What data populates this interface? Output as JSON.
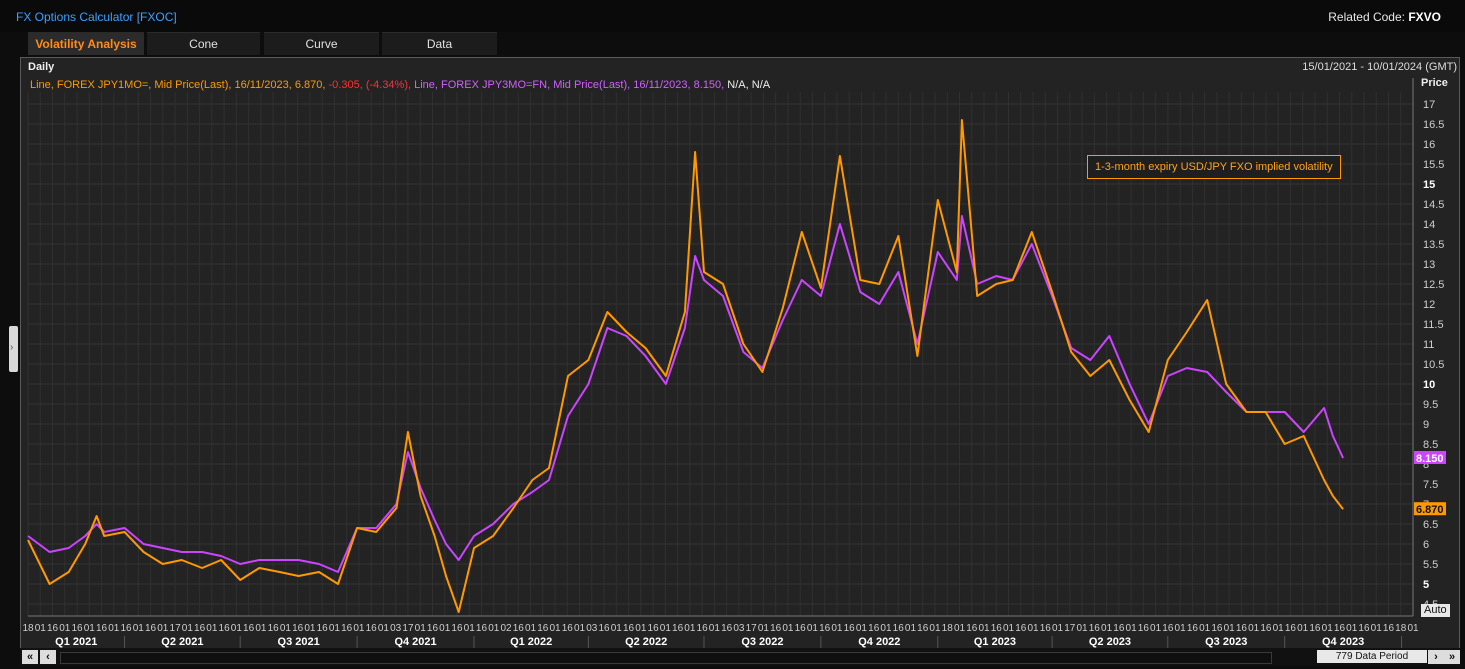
{
  "header": {
    "app_title": "FX Options Calculator [FXOC]",
    "related_label": "Related Code:",
    "related_code": "FXVO"
  },
  "tabs": [
    {
      "label": "Volatility Analysis",
      "active": true
    },
    {
      "label": "Cone",
      "active": false
    },
    {
      "label": "Curve",
      "active": false
    },
    {
      "label": "Data",
      "active": false
    }
  ],
  "chart_header": {
    "interval": "Daily",
    "date_range": "15/01/2021 - 10/01/2024 (GMT)"
  },
  "legend": {
    "s1_desc": "Line, FOREX JPY1MO=, Mid Price(Last),",
    "s1_date": "16/11/2023,",
    "s1_val": "6.870,",
    "s1_chg": "-0.305,",
    "s1_pct": "(-4.34%),",
    "s2_desc": "Line, FOREX JPY3MO=FN, Mid Price(Last),",
    "s2_date": "16/11/2023,",
    "s2_val": "8.150,",
    "s2_na": "N/A, N/A"
  },
  "annotation": "1-3-month expiry USD/JPY FXO implied volatility",
  "price_axis_label": "Price",
  "auto_label": "Auto",
  "period_label": "779 Data Period",
  "nav": {
    "first": "«",
    "prev": "‹",
    "next": "›",
    "last": "»"
  },
  "colors": {
    "series1": "#ff9900",
    "series2": "#cc44ff",
    "background": "#232323",
    "grid": "#333333"
  },
  "chart_data": {
    "type": "line",
    "ylim": [
      4.2,
      17.3
    ],
    "y_ticks": [
      4.5,
      5,
      5.5,
      6,
      6.5,
      7,
      7.5,
      8,
      8.5,
      9,
      9.5,
      10,
      10.5,
      11,
      11.5,
      12,
      12.5,
      13,
      13.5,
      14,
      14.5,
      15,
      15.5,
      16,
      16.5,
      17
    ],
    "y_bold_ticks": [
      5,
      10,
      15
    ],
    "x_day_ticks": [
      "18",
      "01",
      "16",
      "01",
      "16",
      "01",
      "16",
      "01",
      "16",
      "01",
      "16",
      "01",
      "17",
      "01",
      "16",
      "01",
      "16",
      "01",
      "16",
      "01",
      "16",
      "01",
      "16",
      "01",
      "16",
      "01",
      "16",
      "01",
      "16",
      "01",
      "03",
      "17",
      "01",
      "16",
      "01",
      "16",
      "01",
      "16",
      "01",
      "02",
      "16",
      "01",
      "16",
      "01",
      "16",
      "01",
      "03",
      "16",
      "01",
      "16",
      "01",
      "16",
      "01",
      "16",
      "01",
      "16",
      "01",
      "16",
      "03",
      "17",
      "01",
      "16",
      "01",
      "16",
      "01",
      "16",
      "01",
      "16",
      "01",
      "16",
      "01",
      "16",
      "01",
      "16",
      "01",
      "18",
      "01",
      "16",
      "01",
      "16",
      "01",
      "16",
      "01",
      "16",
      "01",
      "17",
      "01",
      "16",
      "01",
      "16",
      "01",
      "16",
      "01",
      "16",
      "01",
      "16",
      "01",
      "16",
      "01",
      "16",
      "01",
      "16",
      "01",
      "16",
      "01",
      "16",
      "01",
      "16",
      "01",
      "16",
      "01",
      "16",
      "18",
      "01"
    ],
    "quarters": [
      "Q1 2021",
      "Q2 2021",
      "Q3 2021",
      "Q4 2021",
      "Q1 2022",
      "Q2 2022",
      "Q3 2022",
      "Q4 2022",
      "Q1 2023",
      "Q2 2023",
      "Q3 2023",
      "Q4 2023"
    ],
    "last_values": {
      "JPY3MO=FN": "8.150",
      "JPY1MO=": "6.870"
    },
    "series": [
      {
        "name": "FOREX JPY1MO=",
        "points": [
          [
            "2021-01-15",
            6.1
          ],
          [
            "2021-02-01",
            5.0
          ],
          [
            "2021-02-16",
            5.3
          ],
          [
            "2021-03-01",
            6.0
          ],
          [
            "2021-03-10",
            6.7
          ],
          [
            "2021-03-16",
            6.2
          ],
          [
            "2021-04-01",
            6.3
          ],
          [
            "2021-04-16",
            5.8
          ],
          [
            "2021-05-01",
            5.5
          ],
          [
            "2021-05-16",
            5.6
          ],
          [
            "2021-06-01",
            5.4
          ],
          [
            "2021-06-16",
            5.6
          ],
          [
            "2021-07-01",
            5.1
          ],
          [
            "2021-07-16",
            5.4
          ],
          [
            "2021-08-01",
            5.3
          ],
          [
            "2021-08-16",
            5.2
          ],
          [
            "2021-09-01",
            5.3
          ],
          [
            "2021-09-16",
            5.0
          ],
          [
            "2021-10-01",
            6.4
          ],
          [
            "2021-10-16",
            6.3
          ],
          [
            "2021-11-01",
            6.9
          ],
          [
            "2021-11-10",
            8.8
          ],
          [
            "2021-11-20",
            7.2
          ],
          [
            "2021-12-01",
            6.2
          ],
          [
            "2021-12-10",
            5.2
          ],
          [
            "2021-12-20",
            4.3
          ],
          [
            "2022-01-01",
            5.9
          ],
          [
            "2022-01-16",
            6.2
          ],
          [
            "2022-02-01",
            6.9
          ],
          [
            "2022-02-16",
            7.6
          ],
          [
            "2022-03-01",
            7.9
          ],
          [
            "2022-03-16",
            10.2
          ],
          [
            "2022-04-01",
            10.6
          ],
          [
            "2022-04-16",
            11.8
          ],
          [
            "2022-05-01",
            11.3
          ],
          [
            "2022-05-16",
            10.9
          ],
          [
            "2022-06-01",
            10.2
          ],
          [
            "2022-06-16",
            11.8
          ],
          [
            "2022-06-24",
            15.8
          ],
          [
            "2022-07-01",
            12.8
          ],
          [
            "2022-07-16",
            12.5
          ],
          [
            "2022-08-01",
            11.0
          ],
          [
            "2022-08-16",
            10.3
          ],
          [
            "2022-09-01",
            11.9
          ],
          [
            "2022-09-16",
            13.8
          ],
          [
            "2022-10-01",
            12.4
          ],
          [
            "2022-10-16",
            15.7
          ],
          [
            "2022-11-01",
            12.6
          ],
          [
            "2022-11-16",
            12.5
          ],
          [
            "2022-12-01",
            13.7
          ],
          [
            "2022-12-16",
            10.7
          ],
          [
            "2023-01-01",
            14.6
          ],
          [
            "2023-01-16",
            12.8
          ],
          [
            "2023-01-20",
            16.6
          ],
          [
            "2023-02-01",
            12.2
          ],
          [
            "2023-02-16",
            12.5
          ],
          [
            "2023-03-01",
            12.6
          ],
          [
            "2023-03-16",
            13.8
          ],
          [
            "2023-04-01",
            12.3
          ],
          [
            "2023-04-16",
            10.8
          ],
          [
            "2023-05-01",
            10.2
          ],
          [
            "2023-05-16",
            10.6
          ],
          [
            "2023-06-01",
            9.6
          ],
          [
            "2023-06-16",
            8.8
          ],
          [
            "2023-07-01",
            10.6
          ],
          [
            "2023-07-16",
            11.3
          ],
          [
            "2023-08-01",
            12.1
          ],
          [
            "2023-08-16",
            10.0
          ],
          [
            "2023-09-01",
            9.3
          ],
          [
            "2023-09-16",
            9.3
          ],
          [
            "2023-10-01",
            8.5
          ],
          [
            "2023-10-16",
            8.7
          ],
          [
            "2023-11-01",
            7.6
          ],
          [
            "2023-11-08",
            7.2
          ],
          [
            "2023-11-16",
            6.87
          ]
        ]
      },
      {
        "name": "FOREX JPY3MO=FN",
        "points": [
          [
            "2021-01-15",
            6.2
          ],
          [
            "2021-02-01",
            5.8
          ],
          [
            "2021-02-16",
            5.9
          ],
          [
            "2021-03-01",
            6.2
          ],
          [
            "2021-03-10",
            6.5
          ],
          [
            "2021-03-16",
            6.3
          ],
          [
            "2021-04-01",
            6.4
          ],
          [
            "2021-04-16",
            6.0
          ],
          [
            "2021-05-01",
            5.9
          ],
          [
            "2021-05-16",
            5.8
          ],
          [
            "2021-06-01",
            5.8
          ],
          [
            "2021-06-16",
            5.7
          ],
          [
            "2021-07-01",
            5.5
          ],
          [
            "2021-07-16",
            5.6
          ],
          [
            "2021-08-01",
            5.6
          ],
          [
            "2021-08-16",
            5.6
          ],
          [
            "2021-09-01",
            5.5
          ],
          [
            "2021-09-16",
            5.3
          ],
          [
            "2021-10-01",
            6.4
          ],
          [
            "2021-10-16",
            6.4
          ],
          [
            "2021-11-01",
            7.0
          ],
          [
            "2021-11-10",
            8.3
          ],
          [
            "2021-11-20",
            7.4
          ],
          [
            "2021-12-01",
            6.6
          ],
          [
            "2021-12-10",
            6.0
          ],
          [
            "2021-12-20",
            5.6
          ],
          [
            "2022-01-01",
            6.2
          ],
          [
            "2022-01-16",
            6.5
          ],
          [
            "2022-02-01",
            7.0
          ],
          [
            "2022-02-16",
            7.3
          ],
          [
            "2022-03-01",
            7.6
          ],
          [
            "2022-03-16",
            9.2
          ],
          [
            "2022-04-01",
            10.0
          ],
          [
            "2022-04-16",
            11.4
          ],
          [
            "2022-05-01",
            11.2
          ],
          [
            "2022-05-16",
            10.7
          ],
          [
            "2022-06-01",
            10.0
          ],
          [
            "2022-06-16",
            11.4
          ],
          [
            "2022-06-24",
            13.2
          ],
          [
            "2022-07-01",
            12.6
          ],
          [
            "2022-07-16",
            12.2
          ],
          [
            "2022-08-01",
            10.8
          ],
          [
            "2022-08-16",
            10.4
          ],
          [
            "2022-09-01",
            11.6
          ],
          [
            "2022-09-16",
            12.6
          ],
          [
            "2022-10-01",
            12.2
          ],
          [
            "2022-10-16",
            14.0
          ],
          [
            "2022-11-01",
            12.3
          ],
          [
            "2022-11-16",
            12.0
          ],
          [
            "2022-12-01",
            12.8
          ],
          [
            "2022-12-16",
            11.0
          ],
          [
            "2023-01-01",
            13.3
          ],
          [
            "2023-01-16",
            12.6
          ],
          [
            "2023-01-20",
            14.2
          ],
          [
            "2023-02-01",
            12.5
          ],
          [
            "2023-02-16",
            12.7
          ],
          [
            "2023-03-01",
            12.6
          ],
          [
            "2023-03-16",
            13.5
          ],
          [
            "2023-04-01",
            12.2
          ],
          [
            "2023-04-16",
            10.9
          ],
          [
            "2023-05-01",
            10.6
          ],
          [
            "2023-05-16",
            11.2
          ],
          [
            "2023-06-01",
            10.0
          ],
          [
            "2023-06-16",
            9.0
          ],
          [
            "2023-07-01",
            10.2
          ],
          [
            "2023-07-16",
            10.4
          ],
          [
            "2023-08-01",
            10.3
          ],
          [
            "2023-08-16",
            9.8
          ],
          [
            "2023-09-01",
            9.3
          ],
          [
            "2023-09-16",
            9.3
          ],
          [
            "2023-10-01",
            9.3
          ],
          [
            "2023-10-16",
            8.8
          ],
          [
            "2023-11-01",
            9.4
          ],
          [
            "2023-11-08",
            8.7
          ],
          [
            "2023-11-16",
            8.15
          ]
        ]
      }
    ]
  }
}
